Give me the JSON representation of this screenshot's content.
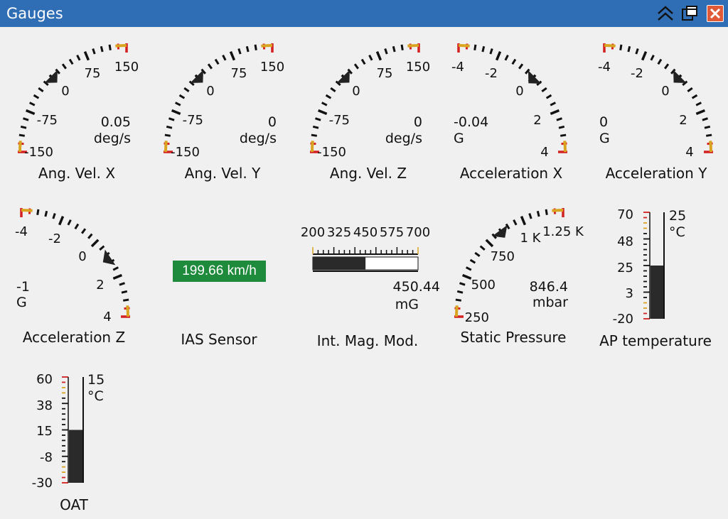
{
  "window": {
    "title": "Gauges"
  },
  "titlebar": {
    "icons": [
      "collapse-icon",
      "restore-icon",
      "close-icon"
    ]
  },
  "colors": {
    "titlebar": "#2f6eb5",
    "needle": "#222222",
    "red": "#d32020",
    "amber": "#d9a520",
    "ias_bg": "#1e8a3c",
    "bar": "#2a2a2a"
  },
  "gauges": [
    {
      "label": "Ang. Vel. X",
      "value_text": "0.05",
      "unit": "deg/s",
      "ticks": [
        "-150",
        "-75",
        "0",
        "75",
        "150"
      ],
      "min": -150,
      "max": 150,
      "value": 0.05,
      "mirror": false
    },
    {
      "label": "Ang. Vel. Y",
      "value_text": "0",
      "unit": "deg/s",
      "ticks": [
        "-150",
        "-75",
        "0",
        "75",
        "150"
      ],
      "min": -150,
      "max": 150,
      "value": 0,
      "mirror": false
    },
    {
      "label": "Ang. Vel. Z",
      "value_text": "0",
      "unit": "deg/s",
      "ticks": [
        "-150",
        "-75",
        "0",
        "75",
        "150"
      ],
      "min": -150,
      "max": 150,
      "value": 0,
      "mirror": false
    },
    {
      "label": "Acceleration X",
      "value_text": "-0.04",
      "unit": "G",
      "ticks": [
        "-4",
        "-2",
        "0",
        "2",
        "4"
      ],
      "min": -4,
      "max": 4,
      "value": -0.04,
      "mirror": true
    },
    {
      "label": "Acceleration Y",
      "value_text": "0",
      "unit": "G",
      "ticks": [
        "-4",
        "-2",
        "0",
        "2",
        "4"
      ],
      "min": -4,
      "max": 4,
      "value": 0,
      "mirror": true
    },
    {
      "label": "Acceleration Z",
      "value_text": "-1",
      "unit": "G",
      "ticks": [
        "-4",
        "-2",
        "0",
        "2",
        "4"
      ],
      "min": -4,
      "max": 4,
      "value": -1,
      "mirror": true
    },
    {
      "label": "Static Pressure",
      "value_text": "846.4",
      "unit": "mbar",
      "ticks": [
        "250",
        "500",
        "750",
        "1 K",
        "1.25 K"
      ],
      "min": 250,
      "max": 1250,
      "value": 846.4,
      "mirror": false
    }
  ],
  "ias": {
    "label": "IAS Sensor",
    "value_text": "199.66 km/h"
  },
  "mag": {
    "label": "Int. Mag. Mod.",
    "ticks": [
      "200",
      "325",
      "450",
      "575",
      "700"
    ],
    "min": 200,
    "max": 700,
    "value": 450.44,
    "value_text": "450.44",
    "unit": "mG"
  },
  "thermo": [
    {
      "label": "AP temperature",
      "ticks": [
        "70",
        "48",
        "25",
        "3",
        "-20"
      ],
      "min": -20,
      "max": 70,
      "value": 25,
      "value_text": "25",
      "unit": "°C"
    },
    {
      "label": "OAT",
      "ticks": [
        "60",
        "38",
        "15",
        "-8",
        "-30"
      ],
      "min": -30,
      "max": 60,
      "value": 15,
      "value_text": "15",
      "unit": "°C"
    }
  ]
}
